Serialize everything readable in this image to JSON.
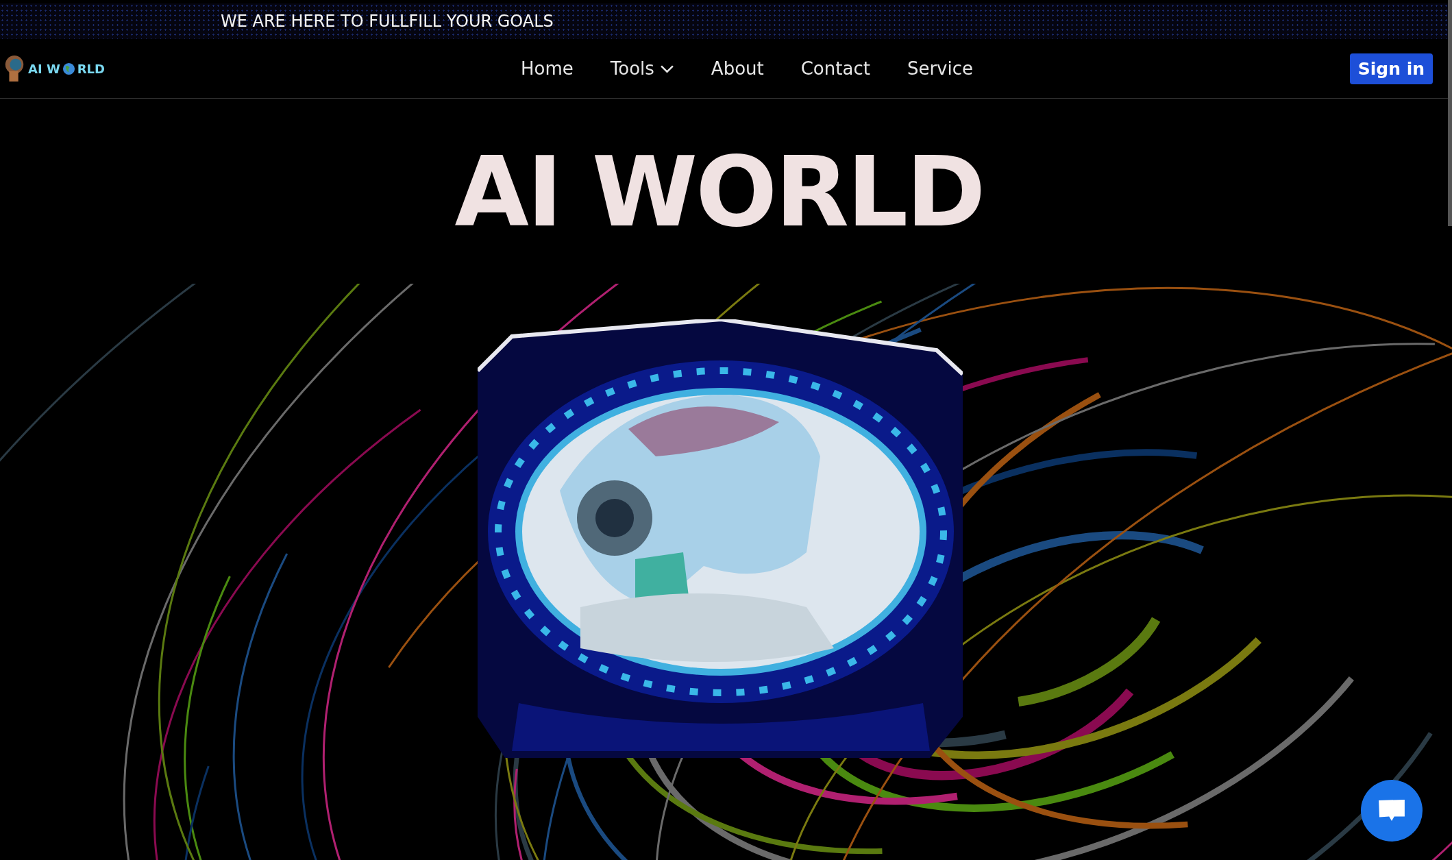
{
  "top_banner": {
    "text": "WE ARE HERE TO FULLFILL YOUR GOALS"
  },
  "logo": {
    "text_before_globe": "AI W",
    "text_after_globe": "RLD"
  },
  "nav": [
    {
      "label": "Home",
      "dropdown": false
    },
    {
      "label": "Tools",
      "dropdown": true
    },
    {
      "label": "About",
      "dropdown": false
    },
    {
      "label": "Contact",
      "dropdown": false
    },
    {
      "label": "Service",
      "dropdown": false
    }
  ],
  "sign_in": {
    "label": "Sign in"
  },
  "hero": {
    "title": "AI WORLD"
  },
  "chat_button": {
    "kind": "chat"
  }
}
